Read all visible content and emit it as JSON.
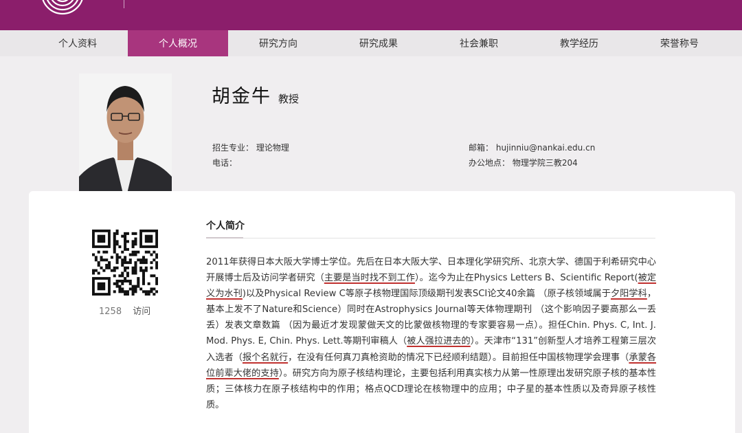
{
  "nav": {
    "items": [
      {
        "label": ""
      },
      {
        "label": "个人资料"
      },
      {
        "label": "个人概况"
      },
      {
        "label": "研究方向"
      },
      {
        "label": "研究成果"
      },
      {
        "label": "社会兼职"
      },
      {
        "label": "教学经历"
      },
      {
        "label": "荣誉称号"
      }
    ],
    "active_index": 2
  },
  "profile": {
    "name": "胡金牛",
    "title": "教授",
    "major_label": "招生专业：",
    "major_value": "理论物理",
    "phone_label": "电话：",
    "phone_value": "",
    "email_label": "邮箱：",
    "email_value": "hujinniu@nankai.edu.cn",
    "office_label": "办公地点：",
    "office_value": "物理学院三教204"
  },
  "visits": {
    "count": "1258",
    "label": "访问"
  },
  "section": {
    "title": "个人简介"
  },
  "bio": {
    "s1": "2011年获得日本大阪大学博士学位。先后在日本大阪大学、日本理化学研究所、北京大学、德国于利希研究中心开展博士后及访问学者研究（",
    "h1": "主要是当时找不到工作",
    "s2": "）。迄今为止在Physics Letters B、Scientific Report(",
    "h2": "被定义为水刊",
    "s3": ")以及Physical Review C等原子核物理国际顶级期刊发表SCI论文40余篇 （原子核领域属于",
    "h3": "夕阳学科",
    "s4": "，基本上发不了Nature和Science）同时在Astrophysics Journal等天体物理期刊 （这个影响因子要高那么一丢丢）发表文章数篇 （因为最近才发现蒙做天文的比蒙做核物理的专家要容易一点）。担任Chin. Phys. C, Int. J. Mod. Phys. E, Chin. Phys. Lett.等期刊审稿人（",
    "h4": "被人强拉进去的",
    "s5": "）。天津市“131”创新型人才培养工程第三层次入选者（",
    "h5": "报个名就行",
    "s6": "，在没有任何真刀真枪资助的情况下已经顺利结题）。目前担任中国核物理学会理事（",
    "h6": "承蒙各位前辈大佬的支持",
    "s7": "）。研究方向为原子核结构理论，主要包括利用真实核力从第一性原理出发研究原子核的基本性质；三体核力在原子核结构中的作用；格点QCD理论在核物理中的应用；中子星的基本性质以及奇异原子核性质。"
  },
  "colors": {
    "brand": "#8b1e6b",
    "nav_active": "#a8357e",
    "annotation": "#c0302e"
  }
}
